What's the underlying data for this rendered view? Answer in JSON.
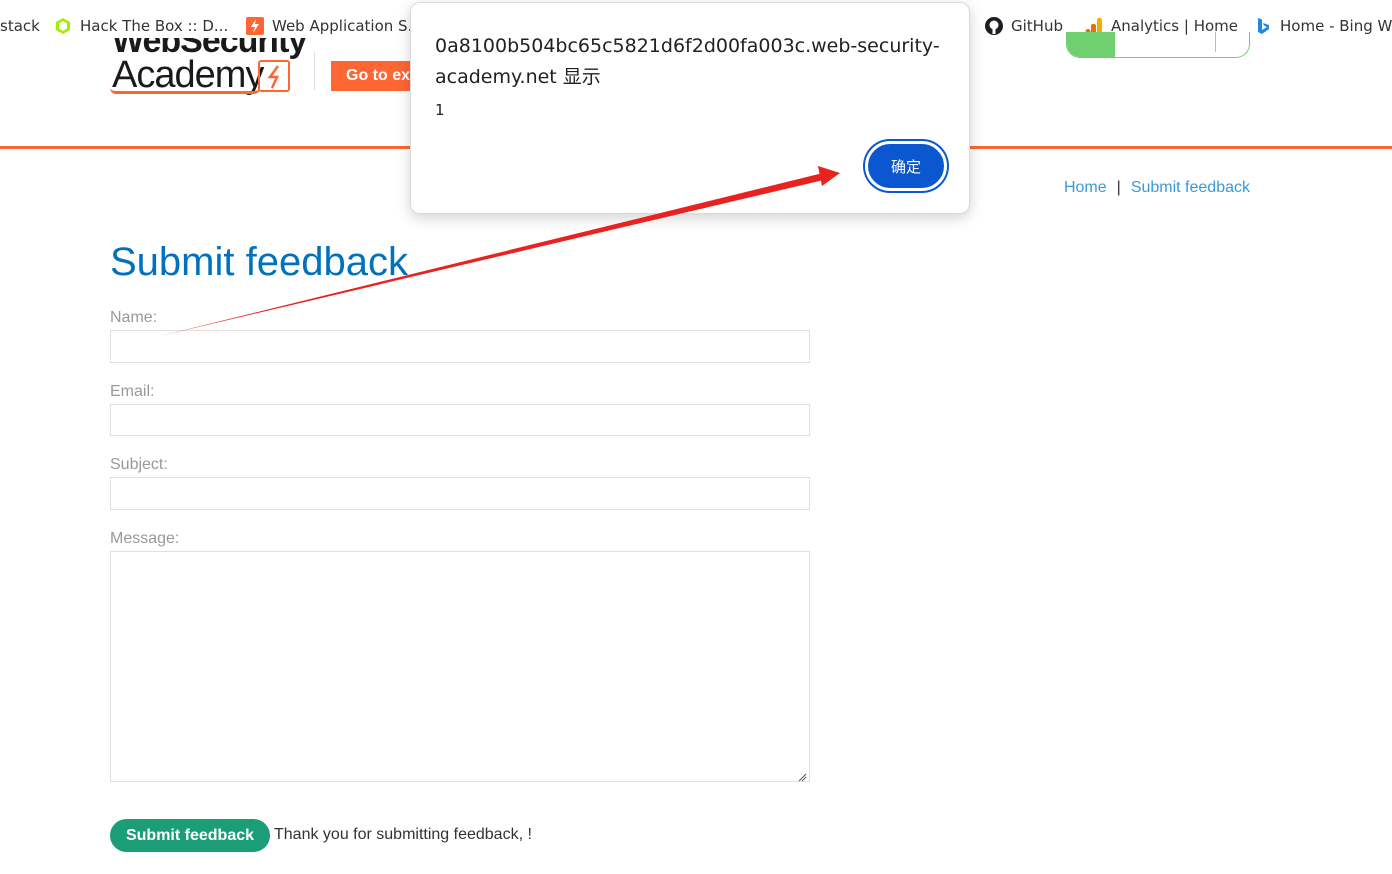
{
  "bookmarks": [
    {
      "label": "stack",
      "icon": "none"
    },
    {
      "label": "Hack The Box :: D...",
      "icon": "hackthebox-icon"
    },
    {
      "label": "Web Application S...",
      "icon": "portswigger-icon"
    },
    {
      "label": "GitHub",
      "icon": "github-icon"
    },
    {
      "label": "Analytics | Home",
      "icon": "analytics-icon"
    },
    {
      "label": "Home - Bing W",
      "icon": "bing-icon"
    }
  ],
  "header": {
    "logo_line1": "WebSecurity",
    "logo_line2": "Academy",
    "goto_label": "Go to exploit server"
  },
  "breadcrumbs": {
    "home": "Home",
    "separator": "|",
    "current": "Submit feedback"
  },
  "form": {
    "title": "Submit feedback",
    "name_label": "Name:",
    "email_label": "Email:",
    "subject_label": "Subject:",
    "message_label": "Message:",
    "name_value": "",
    "email_value": "",
    "subject_value": "",
    "message_value": "",
    "submit_label": "Submit feedback",
    "thanks_text": "Thank you for submitting feedback, !"
  },
  "dialog": {
    "origin": "0a8100b504bc65c5821d6f2d00fa003c.web-security-academy.net 显示",
    "message": "1",
    "ok_label": "确定"
  },
  "colors": {
    "accent_orange": "#ff6633",
    "title_blue": "#0071bc",
    "link_blue": "#3a9ad9",
    "submit_green": "#1b9e77",
    "dialog_button": "#0b57d0",
    "annotation_red": "#e8231f"
  }
}
